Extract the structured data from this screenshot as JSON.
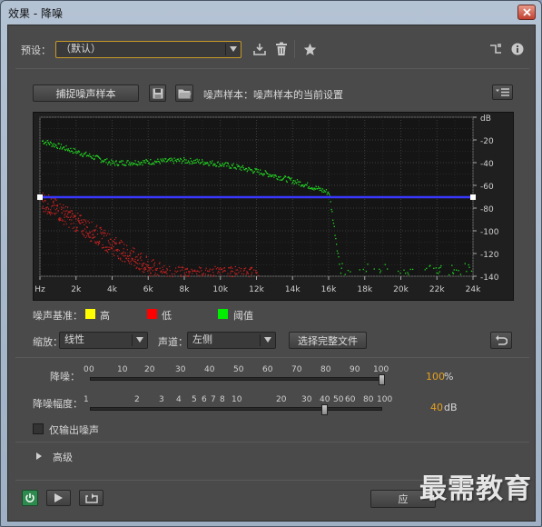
{
  "window": {
    "title": "效果 - 降噪"
  },
  "preset": {
    "label": "预设：",
    "value": "（默认）"
  },
  "capture": {
    "button_label": "捕捉噪声样本",
    "sample_text": "噪声样本：噪声样本的当前设置"
  },
  "graph": {
    "y_ticks": [
      "dB",
      "-20",
      "-40",
      "-60",
      "-80",
      "-100",
      "-120",
      "-140"
    ],
    "x_ticks": [
      "Hz",
      "2k",
      "4k",
      "6k",
      "8k",
      "10k",
      "12k",
      "14k",
      "16k",
      "18k",
      "20k",
      "22k",
      "24k"
    ]
  },
  "legend": {
    "label": "噪声基准：",
    "high": "高",
    "low": "低",
    "threshold": "阈值",
    "colors": {
      "high": "#ffff00",
      "low": "#ff0000",
      "threshold": "#00ff00"
    }
  },
  "scale": {
    "label": "缩放：",
    "value": "线性"
  },
  "channel": {
    "label": "声道：",
    "value": "左侧"
  },
  "select_file_button": "选择完整文件",
  "reduction": {
    "label": "降噪：",
    "value": "100",
    "unit": "%",
    "ticks": [
      "0",
      "0",
      "10",
      "20",
      "30",
      "40",
      "50",
      "60",
      "70",
      "80",
      "90",
      "100"
    ]
  },
  "reduce_by": {
    "label": "降噪幅度：",
    "value": "40",
    "unit": "dB",
    "ticks": [
      "1",
      "2",
      "3",
      "4",
      "5",
      "6",
      "7",
      "8",
      "10",
      "20",
      "30",
      "40",
      "50",
      "60",
      "80",
      "100"
    ]
  },
  "output_noise_only": {
    "label": "仅输出噪声"
  },
  "advanced": {
    "label": "高级"
  },
  "apply_button": "应",
  "watermark": "最需教育",
  "colors": {
    "accent": "#e5a021",
    "threshold_line": "#3a3aff",
    "green": "#22cc22",
    "red": "#cc2222"
  }
}
